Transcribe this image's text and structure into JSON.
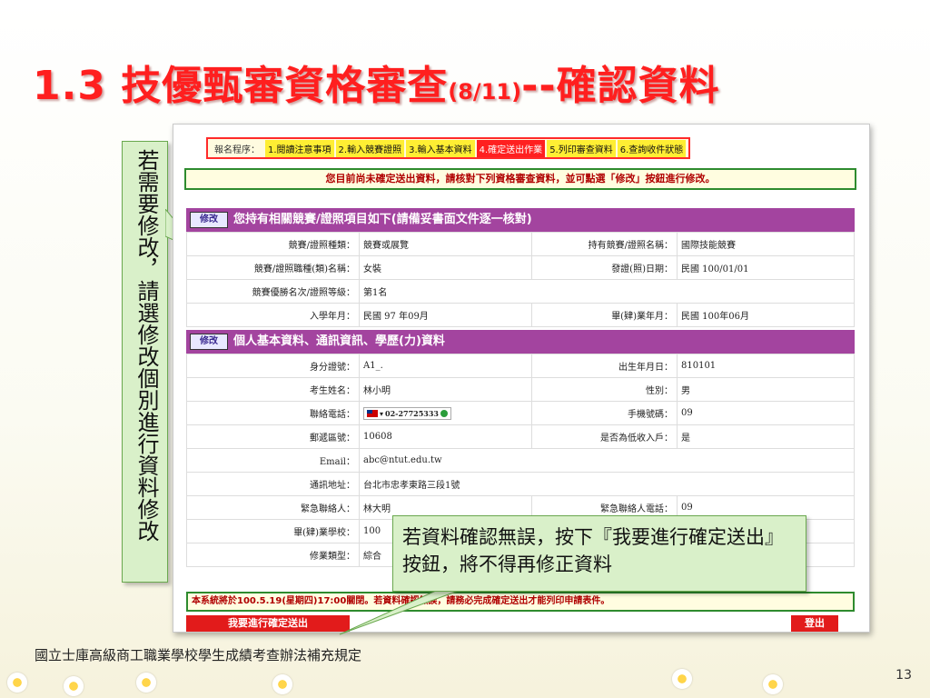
{
  "slide": {
    "title_main": "1.3 技優甄審資格審查",
    "title_sub": "(8/11)",
    "title_tail": "--確認資料",
    "vertical_note": "若需要修改，請選修改個別進行資料修改",
    "bubble_text": "若資料確認無誤，按下『我要進行確定送出』按鈕，將不得再修正資料",
    "source": "國立士庫高級商工職業學校學生成績考查辦法補充規定",
    "page_number": "13"
  },
  "steps": {
    "label": "報名程序：",
    "items": [
      {
        "label": "1.閱讀注意事項",
        "active": false
      },
      {
        "label": "2.輸入競賽證照",
        "active": false
      },
      {
        "label": "3.輸入基本資料",
        "active": false
      },
      {
        "label": "4.確定送出作業",
        "active": true
      },
      {
        "label": "5.列印審查資料",
        "active": false
      },
      {
        "label": "6.查詢收件狀態",
        "active": false
      }
    ]
  },
  "notice": "您目前尚未確定送出資料，請核對下列資格審查資料，並可點選「修改」按鈕進行修改。",
  "section1": {
    "edit_label": "修改",
    "title": "您持有相關競賽/證照項目如下(請備妥書面文件逐一核對)",
    "rows": [
      {
        "k1": "競賽/證照種類：",
        "v1": "競賽或展覽",
        "k2": "持有競賽/證照名稱：",
        "v2": "國際技能競賽"
      },
      {
        "k1": "競賽/證照職種(類)名稱：",
        "v1": "女裝",
        "k2": "發證(照)日期：",
        "v2": "民國 100/01/01"
      },
      {
        "k1": "競賽優勝名次/證照等級：",
        "v1": "第1名",
        "k2": "",
        "v2": ""
      },
      {
        "k1": "入學年月：",
        "v1": "民國 97 年09月",
        "k2": "畢(肄)業年月：",
        "v2": "民國 100年06月"
      }
    ]
  },
  "section2": {
    "edit_label": "修改",
    "title": "個人基本資料、通訊資訊、學歷(力)資料",
    "rows": [
      {
        "k1": "身分證號：",
        "v1": "A1_.",
        "k2": "出生年月日：",
        "v2": "810101"
      },
      {
        "k1": "考生姓名：",
        "v1": "林小明",
        "k2": "性別：",
        "v2": "男"
      },
      {
        "k1": "聯絡電話：",
        "v1": "02-27725333",
        "k2": "手機號碼：",
        "v2": "09"
      },
      {
        "k1": "郵遞區號：",
        "v1": "10608",
        "k2": "是否為低收入戶：",
        "v2": "是"
      },
      {
        "k1": "Email：",
        "v1": "abc@ntut.edu.tw",
        "k2": "",
        "v2": ""
      },
      {
        "k1": "通訊地址：",
        "v1": "台北市忠孝東路三段1號",
        "k2": "",
        "v2": ""
      },
      {
        "k1": "緊急聯絡人：",
        "v1": "林大明",
        "k2": "緊急聯絡人電話：",
        "v2": "09"
      },
      {
        "k1": "畢(肄)業學校：",
        "v1": "100",
        "k2": "",
        "v2": ""
      },
      {
        "k1": "修業類型：",
        "v1": "綜合",
        "k2": "",
        "v2": ""
      }
    ]
  },
  "footer_notice": "本系統將於100.5.19(星期四)17:00關閉。若資料確認無誤，請務必完成確定送出才能列印申請表件。",
  "buttons": {
    "submit": "我要進行確定送出",
    "logout": "登出"
  },
  "colors": {
    "title": "#ff1f1f",
    "section_header": "#a3449f",
    "callout_bg": "#d9f0c9",
    "active_step": "#ff2020",
    "step": "#ffee33"
  }
}
